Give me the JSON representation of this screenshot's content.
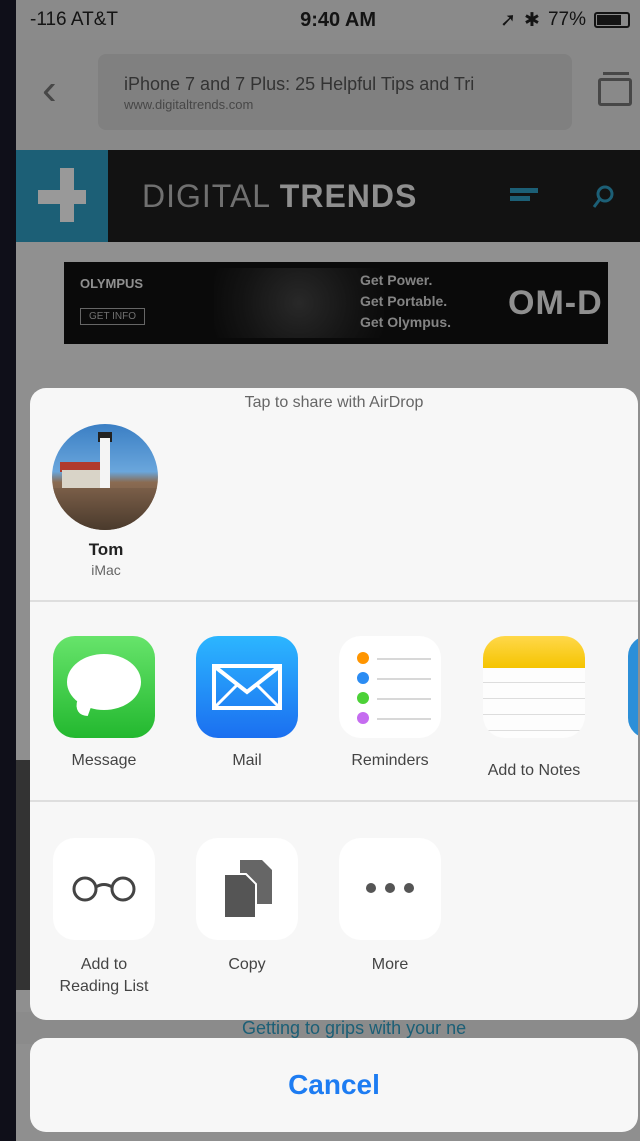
{
  "status_bar": {
    "carrier": "-116 AT&T",
    "time": "9:40 AM",
    "battery": "77%"
  },
  "address_bar": {
    "page_title": "iPhone 7 and 7 Plus: 25 Helpful Tips and Tri",
    "url": "www.digitaltrends.com"
  },
  "site": {
    "name_light": "DIGITAL",
    "name_bold": "TRENDS"
  },
  "ad": {
    "brand": "OLYMPUS",
    "cta": "GET INFO",
    "tagline": [
      "Get Power.",
      "Get Portable.",
      "Get Olympus."
    ],
    "product": "OM-D"
  },
  "share_sheet": {
    "airdrop_hint": "Tap to share with AirDrop",
    "contact": {
      "name": "Tom",
      "device": "iMac"
    },
    "apps": [
      {
        "label": "Message",
        "icon": "messages-icon"
      },
      {
        "label": "Mail",
        "icon": "mail-icon"
      },
      {
        "label": "Reminders",
        "icon": "reminders-icon"
      },
      {
        "label": "Add to Notes",
        "icon": "notes-icon"
      }
    ],
    "actions": [
      {
        "label_line1": "Add to",
        "label_line2": "Reading List",
        "icon": "glasses-icon"
      },
      {
        "label_line1": "Copy",
        "label_line2": "",
        "icon": "copy-icon"
      },
      {
        "label_line1": "More",
        "label_line2": "",
        "icon": "more-icon"
      }
    ],
    "cancel_label": "Cancel"
  },
  "background": {
    "bottom_link": "Getting to grips with your ne"
  },
  "colors": {
    "accent": "#1d7cf2",
    "brand": "#2f9fc5"
  }
}
